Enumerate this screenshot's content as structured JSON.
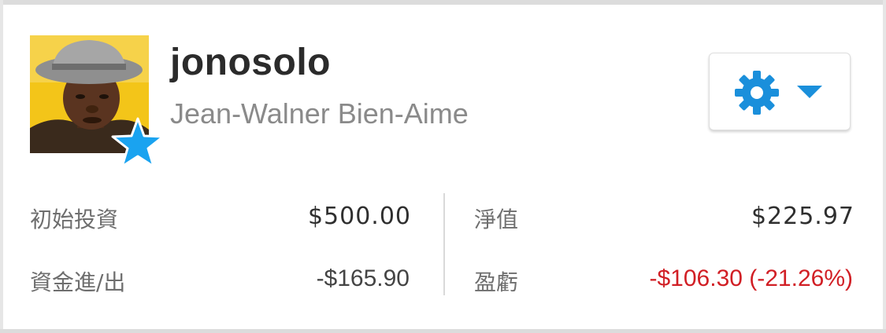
{
  "profile": {
    "username": "jonosolo",
    "full_name": "Jean-Walner Bien-Aime",
    "badge_icon": "star-icon",
    "badge_color": "#1aa3f0"
  },
  "settings": {
    "icon": "gear-icon",
    "dropdown_icon": "caret-down-icon",
    "accent_color": "#1a8fdb"
  },
  "stats": {
    "initial_investment_label": "初始投資",
    "initial_investment_value": "$500.00",
    "funds_in_out_label": "資金進/出",
    "funds_in_out_value": "-$165.90",
    "equity_label": "淨值",
    "equity_value": "$225.97",
    "profit_loss_label": "盈虧",
    "profit_loss_value": "-$106.30 (-21.26%)",
    "negative_color": "#d11f25"
  }
}
